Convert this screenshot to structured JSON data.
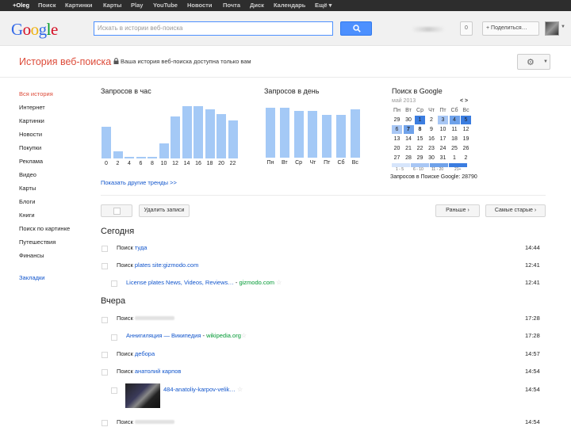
{
  "gbar": [
    "+Oleg",
    "Поиск",
    "Картинки",
    "Карты",
    "Play",
    "YouTube",
    "Новости",
    "Почта",
    "Диск",
    "Календарь",
    "Ещё ▾"
  ],
  "header": {
    "search_placeholder": "Искать в истории веб-поиска",
    "notifications": "0",
    "share_label": "+ Поделиться…"
  },
  "title": {
    "text": "История веб-поиска",
    "private_note": "Ваша история веб-поиска доступна только вам"
  },
  "sidebar": {
    "items": [
      "Вся история",
      "Интернет",
      "Картинки",
      "Новости",
      "Покупки",
      "Реклама",
      "Видео",
      "Карты",
      "Блоги",
      "Книги",
      "Поиск по картинке",
      "Путешествия",
      "Финансы"
    ],
    "bookmarks": "Закладки"
  },
  "chart_data": [
    {
      "type": "bar",
      "title": "Запросов в час",
      "categories": [
        "0",
        "2",
        "4",
        "6",
        "8",
        "10",
        "12",
        "14",
        "16",
        "18",
        "20",
        "22"
      ],
      "values": [
        40,
        9,
        2,
        2,
        2,
        19,
        53,
        66,
        66,
        62,
        56,
        48
      ],
      "ylim": [
        0,
        70
      ]
    },
    {
      "type": "bar",
      "title": "Запросов в день",
      "categories": [
        "Пн",
        "Вт",
        "Ср",
        "Чт",
        "Пт",
        "Сб",
        "Вс"
      ],
      "values": [
        78,
        77,
        73,
        72,
        67,
        67,
        75
      ],
      "ylim": [
        0,
        80
      ]
    }
  ],
  "trends_link": "Показать другие тренды >>",
  "calendar": {
    "title": "Поиск в Google",
    "month": "май 2013",
    "nav": "< >",
    "weekdays": [
      "Пн",
      "Вт",
      "Ср",
      "Чт",
      "Пт",
      "Сб",
      "Вс"
    ],
    "weeks": [
      [
        {
          "d": "29",
          "l": 0
        },
        {
          "d": "30",
          "l": 0
        },
        {
          "d": "1",
          "l": 4
        },
        {
          "d": "2",
          "l": 0
        },
        {
          "d": "3",
          "l": 2
        },
        {
          "d": "4",
          "l": 3
        },
        {
          "d": "5",
          "l": 4
        }
      ],
      [
        {
          "d": "6",
          "l": 2
        },
        {
          "d": "7",
          "l": 3,
          "b": true
        },
        {
          "d": "8",
          "l": 0,
          "b": true
        },
        {
          "d": "9",
          "l": 0
        },
        {
          "d": "10",
          "l": 0
        },
        {
          "d": "11",
          "l": 0
        },
        {
          "d": "12",
          "l": 0
        }
      ],
      [
        {
          "d": "13",
          "l": 0
        },
        {
          "d": "14",
          "l": 0
        },
        {
          "d": "15",
          "l": 0
        },
        {
          "d": "16",
          "l": 0
        },
        {
          "d": "17",
          "l": 0
        },
        {
          "d": "18",
          "l": 0
        },
        {
          "d": "19",
          "l": 0
        }
      ],
      [
        {
          "d": "20",
          "l": 0
        },
        {
          "d": "21",
          "l": 0
        },
        {
          "d": "22",
          "l": 0
        },
        {
          "d": "23",
          "l": 0
        },
        {
          "d": "24",
          "l": 0
        },
        {
          "d": "25",
          "l": 0
        },
        {
          "d": "26",
          "l": 0
        }
      ],
      [
        {
          "d": "27",
          "l": 0
        },
        {
          "d": "28",
          "l": 0
        },
        {
          "d": "29",
          "l": 0
        },
        {
          "d": "30",
          "l": 0
        },
        {
          "d": "31",
          "l": 0
        },
        {
          "d": "1",
          "l": 0
        },
        {
          "d": "2",
          "l": 0
        }
      ]
    ],
    "legend": [
      "1 - 5",
      "6 - 10",
      "11 - 20",
      "21+"
    ],
    "total": "Запросов в Поиске Google: 28790"
  },
  "actions": {
    "delete": "Удалить записи",
    "newer": "Раньше ›",
    "older": "Самые старые ›"
  },
  "days": [
    {
      "heading": "Сегодня",
      "rows": [
        {
          "prefix": "Поиск ",
          "query": "туда",
          "time": "14:44"
        },
        {
          "prefix": "Поиск ",
          "query": "plates site:gizmodo.com",
          "time": "12:41"
        },
        {
          "title": "License plates News, Videos, Reviews…",
          "url": "gizmodo.com",
          "time": "12:41"
        }
      ]
    },
    {
      "heading": "Вчера",
      "rows": [
        {
          "prefix": "Поиск ",
          "query": "",
          "time": "17:28"
        },
        {
          "title": "Аннигиляция — Википедия",
          "url": "wikipedia.org",
          "time": "17:28"
        },
        {
          "prefix": "Поиск ",
          "query": "дебора",
          "time": "14:57"
        },
        {
          "prefix": "Поиск ",
          "query": "анатолий карпов",
          "time": "14:54"
        },
        {
          "title": "484-anatoliy-karpov-velik…",
          "url": "",
          "time": "14:54"
        },
        {
          "prefix": "Поиск ",
          "query": "",
          "time": "14:54"
        }
      ]
    }
  ]
}
